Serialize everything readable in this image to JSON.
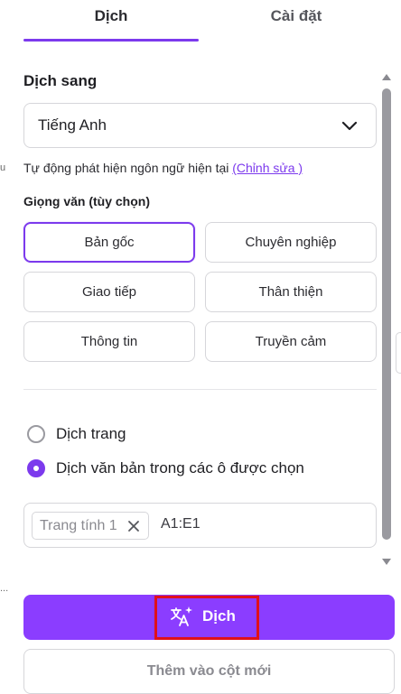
{
  "tabs": [
    {
      "label": "Dịch",
      "active": true
    },
    {
      "label": "Cài đặt",
      "active": false
    }
  ],
  "accent_color": "#7c3aed",
  "primary_color": "#8b3dff",
  "highlight_color": "#e0101a",
  "left_edge_marks": [
    "u",
    "..."
  ],
  "target_language": {
    "title": "Dịch sang",
    "selected": "Tiếng Anh",
    "icon": "chevron-down-icon"
  },
  "auto_detect": {
    "text": "Tự động phát hiện ngôn ngữ hiện tại",
    "edit_link": "(Chỉnh sửa )"
  },
  "tone": {
    "label": "Giọng văn (tùy chọn)",
    "options": [
      "Bản gốc",
      "Chuyên nghiệp",
      "Giao tiếp",
      "Thân thiện",
      "Thông tin",
      "Truyền cảm"
    ],
    "selected": "Bản gốc"
  },
  "scope": {
    "options": [
      "Dịch trang",
      "Dịch văn bản trong các ô được chọn"
    ],
    "selected": "Dịch văn bản trong các ô được chọn"
  },
  "range": {
    "sheet_chip": "Trang tính 1",
    "cells": "A1:E1"
  },
  "actions": {
    "translate_label": "Dịch",
    "translate_icon": "translate-sparkle-icon",
    "add_column_label": "Thêm vào cột mới"
  }
}
